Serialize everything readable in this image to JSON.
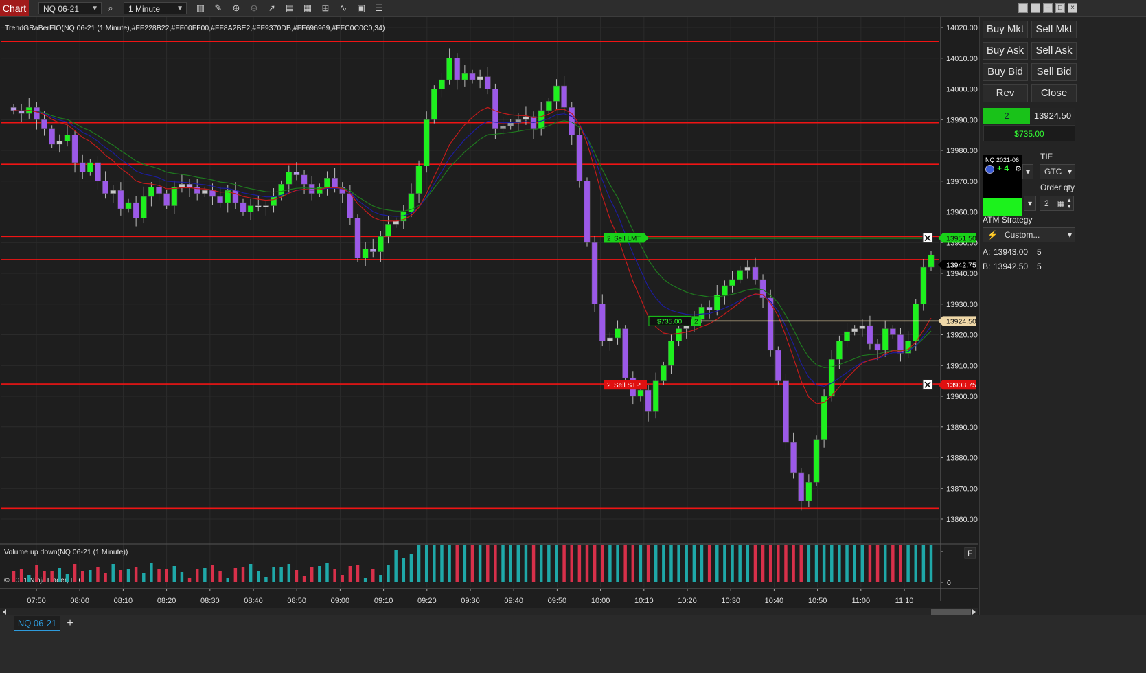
{
  "toolbar": {
    "app_title": "Chart",
    "instrument": "NQ 06-21",
    "interval": "1 Minute",
    "icons": [
      "bar-style-icon",
      "draw-tool-icon",
      "zoom-in-icon",
      "zoom-out-icon",
      "pointer-icon",
      "data-box-icon",
      "properties-icon",
      "strategies-icon",
      "indicators-icon",
      "templates-icon",
      "object-list-icon"
    ]
  },
  "window_controls": [
    "minimize-icon",
    "restore-icon",
    "maximize-icon",
    "close-icon"
  ],
  "chart_data": {
    "type": "candlestick",
    "indicator_label": "TrendGRaBerFIO(NQ 06-21 (1 Minute),#FF228B22,#FF00FF00,#FF8A2BE2,#FF9370DB,#FF696969,#FFC0C0C0,34)",
    "volume_label": "Volume up down(NQ 06-21 (1 Minute))",
    "copyright": "© 2021 NinjaTrader, LLC",
    "y_ticks": [
      "14020.00",
      "14010.00",
      "14000.00",
      "13990.00",
      "13980.00",
      "13970.00",
      "13960.00",
      "13950.00",
      "13940.00",
      "13930.00",
      "13920.00",
      "13910.00",
      "13900.00",
      "13890.00",
      "13880.00",
      "13870.00",
      "13860.00"
    ],
    "y_range": [
      13857,
      14022
    ],
    "x_ticks": [
      "07:50",
      "08:00",
      "08:10",
      "08:20",
      "08:30",
      "08:40",
      "08:50",
      "09:00",
      "09:10",
      "09:20",
      "09:30",
      "09:40",
      "09:50",
      "10:00",
      "10:10",
      "10:20",
      "10:30",
      "10:40",
      "10:50",
      "11:00",
      "11:10"
    ],
    "horizontal_lines": [
      14015.5,
      13989,
      13975.5,
      13952,
      13944.5,
      13904,
      13863.5
    ],
    "volume_axis_zero": "0",
    "volume_flag": "F",
    "orders": [
      {
        "qty": "2",
        "label": "Sell LMT",
        "price": "13951.50",
        "color": "#19d219"
      },
      {
        "qty": "2",
        "label": "Sell STP",
        "price": "13903.75",
        "color": "#e01010"
      }
    ],
    "position": {
      "pnl": "$735.00",
      "qty": "2",
      "price": "13924.50"
    },
    "last_price": "13942.75",
    "series": [
      {
        "name": "Close path",
        "price_path": [
          13993,
          13992,
          13994,
          13990,
          13987,
          13982,
          13983,
          13985,
          13976,
          13973,
          13976,
          13970,
          13966,
          13967,
          13961,
          13963,
          13958,
          13965,
          13968,
          13966,
          13962,
          13968,
          13969,
          13968,
          13966,
          13967,
          13965,
          13963,
          13967,
          13963,
          13960,
          13962,
          13962,
          13962,
          13965,
          13969,
          13973,
          13972,
          13969,
          13966,
          13968,
          13971,
          13968,
          13966,
          13958,
          13945,
          13948,
          13947,
          13952,
          13956,
          13957,
          13960,
          13966,
          13975,
          13990,
          14000,
          14003,
          14010,
          14003,
          14005,
          14003,
          14004,
          14000,
          13987,
          13988,
          13989,
          13990,
          13991,
          13987,
          13993,
          13996,
          14001,
          13994,
          13985,
          13970,
          13950,
          13930,
          13918,
          13919,
          13922,
          13906,
          13900,
          13902,
          13895,
          13905,
          13910,
          13918,
          13922,
          13923,
          13925,
          13929,
          13928,
          13933,
          13936,
          13938,
          13941,
          13942,
          13938,
          13932,
          13915,
          13905,
          13885,
          13875,
          13866,
          13872,
          13886,
          13900,
          13912,
          13918,
          13921,
          13922,
          13923,
          13917,
          13915,
          13922,
          13920,
          13914,
          13918,
          13930,
          13942,
          13946
        ]
      }
    ]
  },
  "right_panel": {
    "buy_mkt": "Buy Mkt",
    "sell_mkt": "Sell Mkt",
    "buy_ask": "Buy Ask",
    "sell_ask": "Sell Ask",
    "buy_bid": "Buy Bid",
    "sell_bid": "Sell Bid",
    "rev": "Rev",
    "close": "Close",
    "pos_qty": "2",
    "pos_price": "13924.50",
    "pos_pnl": "$735.00",
    "instrument_popup_title": "NQ 2021-06",
    "instrument_popup_value": "+ 4",
    "tif_label": "TIF",
    "tif_value": "GTC",
    "order_qty_label": "Order qty",
    "order_qty_value": "2",
    "atm_label": "ATM Strategy",
    "atm_value": "Custom...",
    "ask_label": "A:",
    "ask_price": "13943.00",
    "ask_size": "5",
    "bid_label": "B:",
    "bid_price": "13942.50",
    "bid_size": "5"
  },
  "tabs": {
    "active": "NQ 06-21",
    "add": "+"
  }
}
